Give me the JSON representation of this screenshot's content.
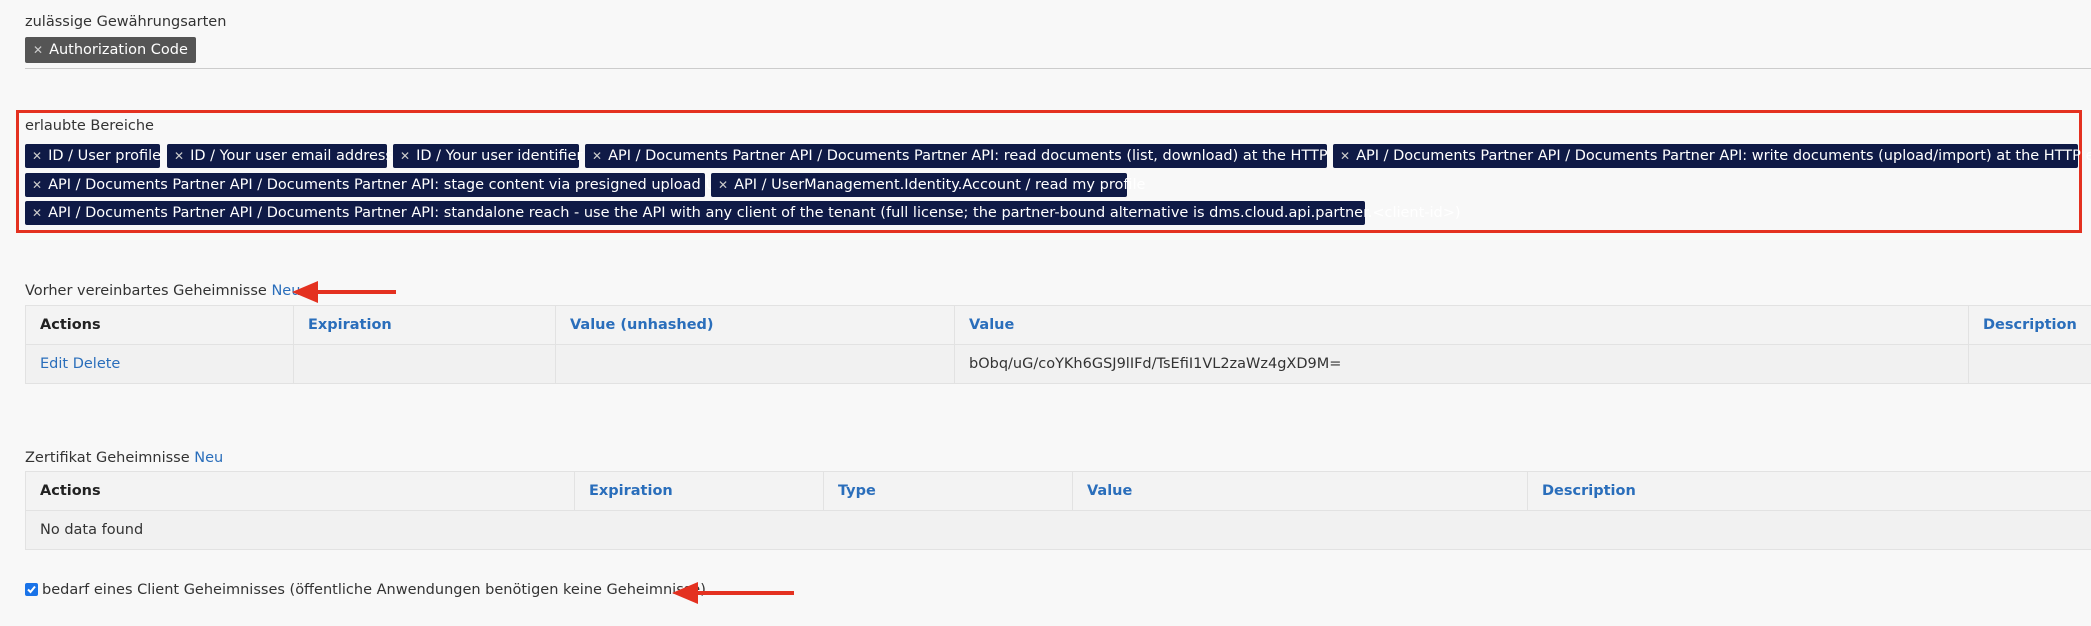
{
  "grant_types": {
    "label": "zulässige Gewährungsarten",
    "tags": [
      "Authorization Code"
    ]
  },
  "scopes": {
    "label": "erlaubte Bereiche",
    "tags": [
      "ID / User profile",
      "ID / Your user email address",
      "ID / Your user identifier",
      "API / Documents Partner API / Documents Partner API: read documents (list, download) at the HTTP edge",
      "API / Documents Partner API / Documents Partner API: write documents (upload/import) at the HTTP edge",
      "API / Documents Partner API / Documents Partner API: stage content via presigned upload URLs",
      "API / UserManagement.Identity.Account / read my profile",
      "API / Documents Partner API / Documents Partner API: standalone reach - use the API with any client of the tenant (full license; the partner-bound alternative is dms.cloud.api.partner.<client-id>)"
    ]
  },
  "shared_secrets": {
    "label": "Vorher vereinbartes Geheimnisse",
    "new_link": "Neu",
    "columns": [
      "Actions",
      "Expiration",
      "Value (unhashed)",
      "Value",
      "Description"
    ],
    "rows": [
      {
        "edit": "Edit",
        "delete": "Delete",
        "expiration": "",
        "value_unhashed": "",
        "value": "bObq/uG/coYKh6GSJ9lIFd/TsEfiI1VL2zaWz4gXD9M=",
        "description": ""
      }
    ]
  },
  "cert_secrets": {
    "label": "Zertifikat Geheimnisse",
    "new_link": "Neu",
    "columns": [
      "Actions",
      "Expiration",
      "Type",
      "Value",
      "Description"
    ],
    "empty_text": "No data found"
  },
  "require_secret": {
    "checked": true,
    "label": "bedarf eines Client Geheimnisses (öffentliche Anwendungen benötigen keine Geheimnisse)"
  },
  "colors": {
    "highlight": "#e43120",
    "scope_tag_bg": "#0f1a46",
    "grant_tag_bg": "#555555",
    "link": "#2a6ebb"
  },
  "icons": [
    "remove-x-icon",
    "annotation-arrow-icon",
    "checkbox-checked-icon"
  ]
}
